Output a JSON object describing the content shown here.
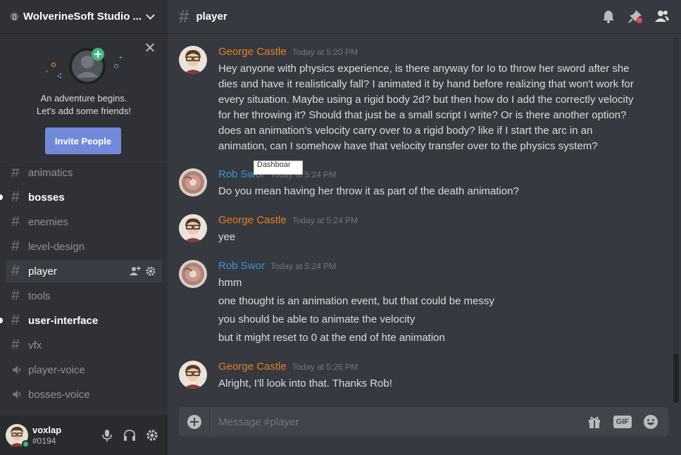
{
  "guild": {
    "name": "WolverineSoft Studio ..."
  },
  "invite": {
    "line1": "An adventure begins.",
    "line2": "Let's add some friends!",
    "button": "Invite People"
  },
  "channels": [
    {
      "name": "animatics",
      "type": "text",
      "state": "normal"
    },
    {
      "name": "bosses",
      "type": "text",
      "state": "unread"
    },
    {
      "name": "enemies",
      "type": "text",
      "state": "normal"
    },
    {
      "name": "level-design",
      "type": "text",
      "state": "normal"
    },
    {
      "name": "player",
      "type": "text",
      "state": "selected"
    },
    {
      "name": "tools",
      "type": "text",
      "state": "normal"
    },
    {
      "name": "user-interface",
      "type": "text",
      "state": "unread"
    },
    {
      "name": "vfx",
      "type": "text",
      "state": "normal"
    },
    {
      "name": "player-voice",
      "type": "voice",
      "state": "normal"
    },
    {
      "name": "bosses-voice",
      "type": "voice",
      "state": "normal"
    }
  ],
  "user": {
    "name": "voxlap",
    "tag": "#0194",
    "status_color": "#43b581"
  },
  "channel_header": {
    "name": "player"
  },
  "messages": [
    {
      "author": "George Castle",
      "time": "Today at 5:20 PM",
      "lines": [
        "Hey anyone with physics experience, is there anyway for Io to throw her sword after she dies and have it realistically fall? I animated it by hand before realizing that won't work for every situation. Maybe using a rigid body 2d? but then how do I add the correctly velocity for her throwing it? Should that just be a small script I write? Or is there another option? does an animation's velocity carry over to a rigid body? like if I start the arc in an animation, can I somehow have that velocity transfer over to the physics system?"
      ]
    },
    {
      "author": "Rob Swor",
      "time": "Today at 5:24 PM",
      "lines": [
        "Do you mean having her throw it as part of the death animation?"
      ]
    },
    {
      "author": "George Castle",
      "time": "Today at 5:24 PM",
      "lines": [
        "yee"
      ]
    },
    {
      "author": "Rob Swor",
      "time": "Today at 5:24 PM",
      "lines": [
        "hmm",
        "one thought is an animation event, but that could be messy",
        "you should be able to animate the velocity",
        "but it might reset to 0 at the end of hte animation"
      ]
    },
    {
      "author": "George Castle",
      "time": "Today at 5:26 PM",
      "lines": [
        "Alright, I'll look into that. Thanks Rob!"
      ]
    }
  ],
  "tooltip": {
    "text": "Dashboar"
  },
  "composer": {
    "placeholder": "Message #player"
  },
  "colors": {
    "george": "#e67e22",
    "rob": "#3498db",
    "accent": "#7289da"
  }
}
